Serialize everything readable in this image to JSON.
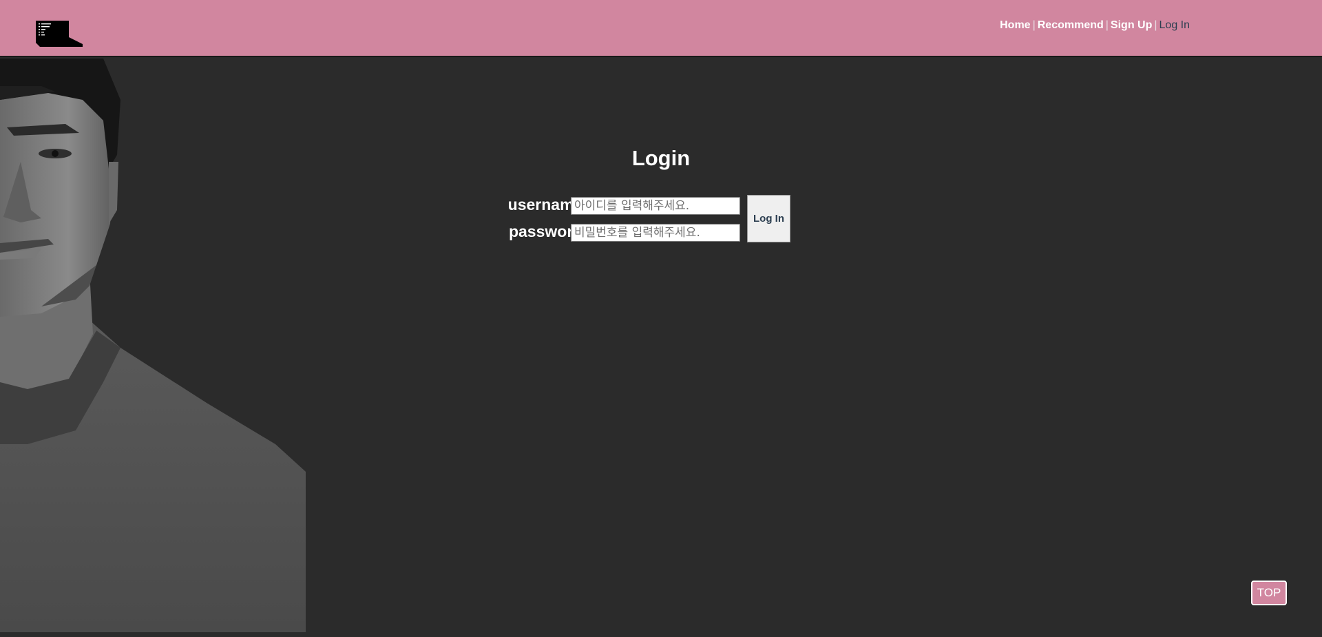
{
  "header": {
    "logo_icon": "laptop-logo-icon",
    "nav": {
      "home": "Home",
      "recommend": "Recommend",
      "signup": "Sign Up",
      "login": "Log In",
      "separator": "|"
    },
    "bg_color": "#d1869f"
  },
  "main": {
    "title": "Login",
    "username_label": "username:",
    "username_placeholder": "아이디를 입력해주세요.",
    "password_label": "password:",
    "password_placeholder": "비밀번호를 입력해주세요.",
    "login_button": "Log In",
    "background_color": "#2b2b2b"
  },
  "top_button": "TOP",
  "colors": {
    "accent": "#d1869f",
    "active_nav": "#2c3e50"
  }
}
